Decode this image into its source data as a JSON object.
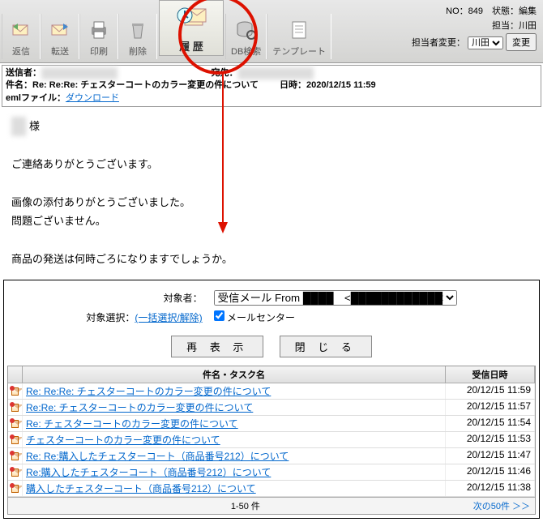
{
  "toolbar": {
    "buttons": [
      {
        "id": "reply",
        "label": "返信"
      },
      {
        "id": "forward",
        "label": "転送"
      },
      {
        "id": "print",
        "label": "印刷"
      },
      {
        "id": "delete",
        "label": "削除"
      },
      {
        "id": "history",
        "label": "履 歴"
      },
      {
        "id": "dbsearch",
        "label": "DB検索"
      },
      {
        "id": "template",
        "label": "テンプレート"
      }
    ]
  },
  "meta": {
    "no_label": "NO：",
    "no": "849",
    "status_label": "状態：",
    "status": "編集",
    "owner_label": "担当：",
    "owner": "川田",
    "owner_change_label": "担当者変更：",
    "owner_select": "川田",
    "change_btn": "変更"
  },
  "headers": {
    "from_label": "送信者：",
    "from": "████████████",
    "to_label": "宛先：",
    "to": "████████████",
    "subject_label": "件名：",
    "subject": "Re: Re:Re: チェスターコートのカラー変更の件について",
    "date_label": "日時：",
    "date": "2020/12/15 11:59",
    "eml_label": "emlファイル：",
    "eml_link": "ダウンロード"
  },
  "body": {
    "line0": "████ 様",
    "line1": "ご連絡ありがとうございます。",
    "line2": "画像の添付ありがとうございました。",
    "line3": "問題ございません。",
    "line4": "商品の発送は何時ごろになりますでしょうか。"
  },
  "history": {
    "target_label": "対象者：",
    "target_select": "受信メール From ████　<████████████>",
    "sel_label": "対象選択：",
    "sel_link": "(一括選択/解除)",
    "mailcenter": "メールセンター",
    "redisplay": "再 表 示",
    "close": "閉 じ る",
    "col_subject": "件名・タスク名",
    "col_date": "受信日時",
    "rows": [
      {
        "subject": "Re: Re:Re: チェスターコートのカラー変更の件について",
        "date": "20/12/15 11:59"
      },
      {
        "subject": "Re:Re: チェスターコートのカラー変更の件について",
        "date": "20/12/15 11:57"
      },
      {
        "subject": "Re: チェスターコートのカラー変更の件について",
        "date": "20/12/15 11:54"
      },
      {
        "subject": "チェスターコートのカラー変更の件について",
        "date": "20/12/15 11:53"
      },
      {
        "subject": "Re: Re:購入したチェスターコート（商品番号212）について",
        "date": "20/12/15 11:47"
      },
      {
        "subject": "Re:購入したチェスターコート（商品番号212）について",
        "date": "20/12/15 11:46"
      },
      {
        "subject": "購入したチェスターコート（商品番号212）について",
        "date": "20/12/15 11:38"
      }
    ],
    "footer_center": "1-50 件",
    "footer_right": "次の50件 ＞＞"
  }
}
